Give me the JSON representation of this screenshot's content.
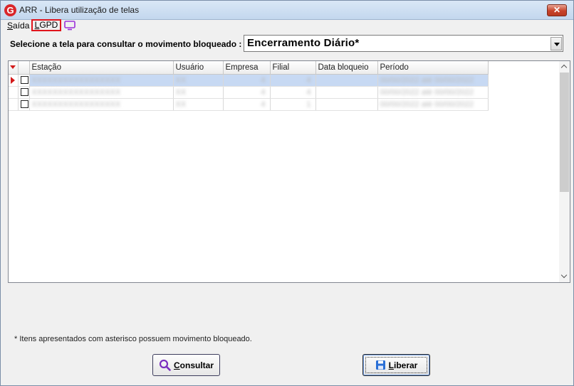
{
  "window": {
    "title": "ARR - Libera utilização de telas",
    "logo_letter": "G",
    "close_glyph": "✕"
  },
  "menu": {
    "saida_first": "S",
    "saida_rest": "aída",
    "lgpd_first": "L",
    "lgpd_rest": "GPD",
    "monitor_icon": "monitor-icon"
  },
  "selector": {
    "label": "Selecione a tela para consultar o movimento bloqueado :",
    "value": "Encerramento Diário*"
  },
  "grid": {
    "columns": [
      "Estação",
      "Usuário",
      "Empresa",
      "Filial",
      "Data bloqueio",
      "Período"
    ],
    "rows": [
      {
        "estacao": "XXXXXXXXXXXXXXXXX",
        "usuario": "XX",
        "empresa": "4",
        "filial": "4",
        "data": "",
        "periodo": "00/00/2022 até 00/00/2022",
        "selected": true
      },
      {
        "estacao": "XXXXXXXXXXXXXXXXX",
        "usuario": "XX",
        "empresa": "4",
        "filial": "4",
        "data": "",
        "periodo": "00/00/2022 até 00/00/2022",
        "selected": false
      },
      {
        "estacao": "XXXXXXXXXXXXXXXXX",
        "usuario": "XX",
        "empresa": "4",
        "filial": "1",
        "data": "",
        "periodo": "00/00/2022 até 00/00/2022",
        "selected": false
      }
    ]
  },
  "footnote": "* Itens apresentados com asterisco possuem movimento bloqueado.",
  "buttons": {
    "consultar_first": "C",
    "consultar_rest": "onsultar",
    "liberar_first": "L",
    "liberar_rest": "iberar"
  },
  "colors": {
    "accent_red": "#e0141c",
    "selection": "#c7d9f3",
    "monitor_purple": "#9b30d9",
    "search_purple": "#7b2fbf",
    "save_blue": "#2a6fd6"
  }
}
